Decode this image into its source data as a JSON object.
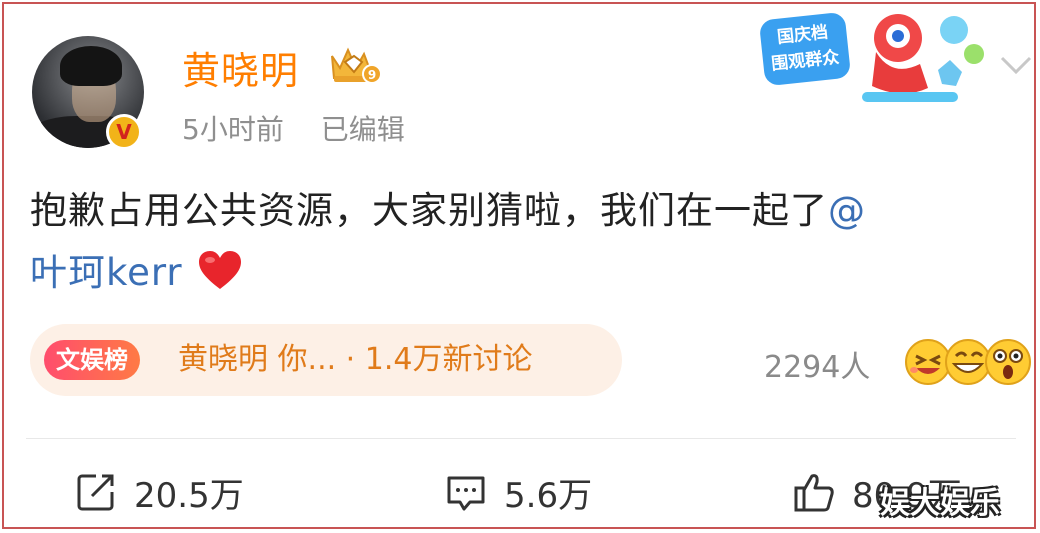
{
  "user": {
    "name": "黄晓明",
    "level_badge": "9",
    "verified_mark": "V"
  },
  "meta": {
    "time": "5小时前",
    "edited": "已编辑"
  },
  "banner": {
    "line1": "国庆档",
    "line2": "围观群众"
  },
  "post": {
    "text": "抱歉占用公共资源，大家别猜啦，我们在一起了",
    "mention_at": "@",
    "mention_name": "叶珂kerr"
  },
  "hot": {
    "tag": "文娱榜",
    "text": "黄晓明 你... · 1.4万新讨论"
  },
  "reactions": {
    "people": "2294人"
  },
  "actions": {
    "repost": "20.5万",
    "comment": "5.6万",
    "like": "80.9万"
  },
  "watermark": "娱大娱乐",
  "colors": {
    "username": "#ff7e00",
    "mention": "#3b6fb5",
    "meta": "#8f8f8f",
    "hot_text": "#e07b1a",
    "frame": "#c85454"
  }
}
